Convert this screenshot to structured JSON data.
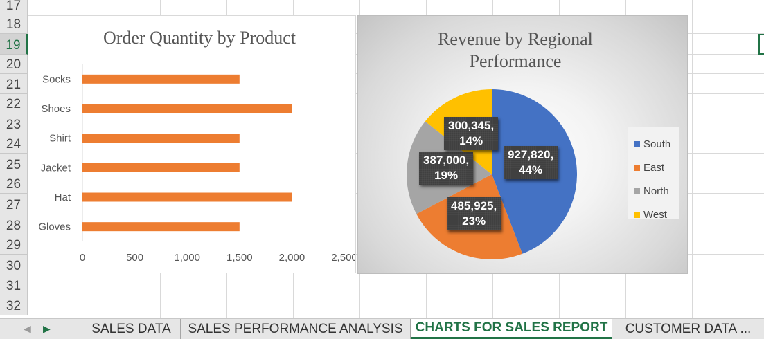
{
  "rows": [
    {
      "num": "17"
    },
    {
      "num": "18"
    },
    {
      "num": "19",
      "active": true
    },
    {
      "num": "20"
    },
    {
      "num": "21"
    },
    {
      "num": "22"
    },
    {
      "num": "23"
    },
    {
      "num": "24"
    },
    {
      "num": "25"
    },
    {
      "num": "26"
    },
    {
      "num": "27"
    },
    {
      "num": "28"
    },
    {
      "num": "29"
    },
    {
      "num": "30"
    },
    {
      "num": "31"
    },
    {
      "num": "32"
    }
  ],
  "chart_data": [
    {
      "type": "bar",
      "orientation": "horizontal",
      "title": "Order Quantity by Product",
      "categories": [
        "Socks",
        "Shoes",
        "Shirt",
        "Jacket",
        "Hat",
        "Gloves"
      ],
      "values": [
        1500,
        2000,
        1500,
        1500,
        2000,
        1500
      ],
      "xlim": [
        0,
        2500
      ],
      "xticks": [
        0,
        500,
        1000,
        1500,
        2000,
        2500
      ],
      "xtick_labels": [
        "0",
        "500",
        "1,000",
        "1,500",
        "2,000",
        "2,500"
      ],
      "bar_color": "#ed7d31",
      "grid": false
    },
    {
      "type": "pie",
      "title_lines": [
        "Revenue by Regional",
        "Performance"
      ],
      "slices": [
        {
          "name": "South",
          "value": 927820,
          "label": "927,820,",
          "pct": "44%",
          "color": "#4472c4"
        },
        {
          "name": "East",
          "value": 485925,
          "label": "485,925,",
          "pct": "23%",
          "color": "#ed7d31"
        },
        {
          "name": "North",
          "value": 387000,
          "label": "387,000,",
          "pct": "19%",
          "color": "#a5a5a5"
        },
        {
          "name": "West",
          "value": 300345,
          "label": "300,345,",
          "pct": "14%",
          "color": "#ffc000"
        }
      ],
      "legend_position": "right"
    }
  ],
  "tabs": {
    "items": [
      {
        "label": "SALES DATA"
      },
      {
        "label": "SALES PERFORMANCE ANALYSIS"
      },
      {
        "label": "CHARTS FOR SALES REPORT",
        "active": true
      },
      {
        "label": "CUSTOMER DATA ..."
      }
    ]
  },
  "colors": {
    "accent": "#217346"
  }
}
